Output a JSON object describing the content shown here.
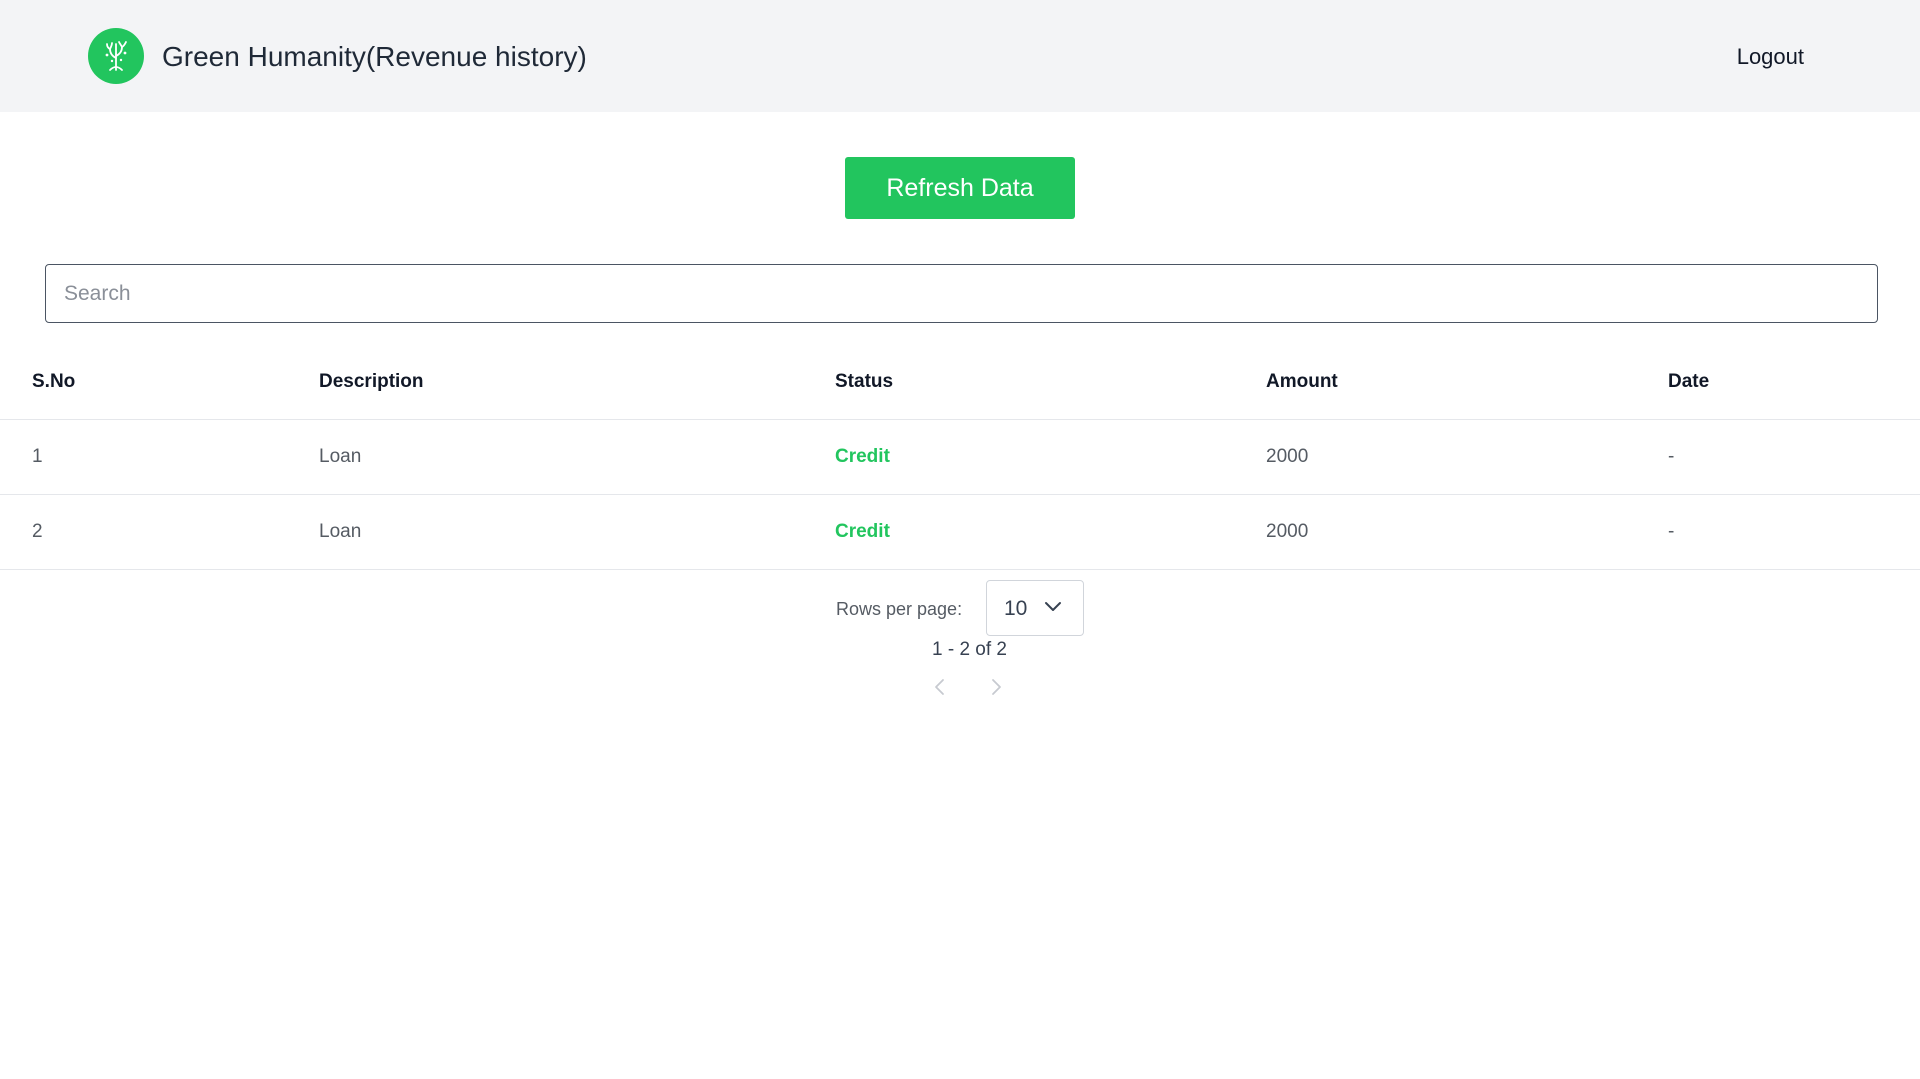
{
  "header": {
    "title": "Green Humanity(Revenue history)",
    "logout_label": "Logout",
    "logo_icon": "tree-icon",
    "brand_color": "#22c55e"
  },
  "toolbar": {
    "refresh_label": "Refresh Data"
  },
  "search": {
    "placeholder": "Search",
    "value": ""
  },
  "table": {
    "columns": [
      "S.No",
      "Description",
      "Status",
      "Amount",
      "Date"
    ],
    "rows": [
      {
        "sno": "1",
        "description": "Loan",
        "status": "Credit",
        "amount": "2000",
        "date": "-"
      },
      {
        "sno": "2",
        "description": "Loan",
        "status": "Credit",
        "amount": "2000",
        "date": "-"
      }
    ],
    "status_color": "#22c55e"
  },
  "pagination": {
    "rows_per_page_label": "Rows per page:",
    "rows_per_page_value": "10",
    "range_text": "1 - 2 of 2",
    "prev_icon": "chevron-left-icon",
    "next_icon": "chevron-right-icon"
  }
}
